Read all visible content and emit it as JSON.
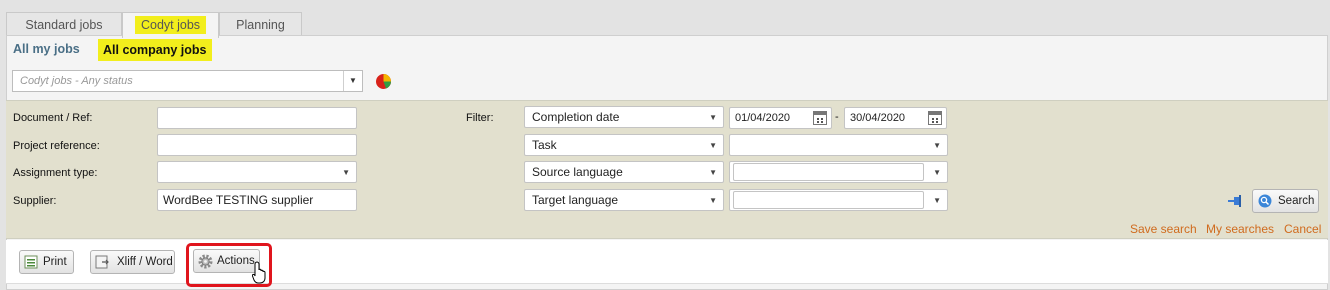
{
  "tabs": [
    {
      "label": "Standard jobs"
    },
    {
      "label": "Codyt jobs"
    },
    {
      "label": "Planning"
    }
  ],
  "subtabs": {
    "mine": "All my jobs",
    "company": "All company jobs"
  },
  "status_select": {
    "value": "Codyt jobs - Any status"
  },
  "form": {
    "document_ref": {
      "label": "Document / Ref:",
      "value": ""
    },
    "project_reference": {
      "label": "Project reference:",
      "value": ""
    },
    "assignment_type": {
      "label": "Assignment type:",
      "value": ""
    },
    "supplier": {
      "label": "Supplier:",
      "value": "WordBee TESTING supplier"
    },
    "filter_label": "Filter:",
    "filters": [
      {
        "field": "Completion date",
        "from": "01/04/2020",
        "to": "30/04/2020",
        "sep": "-"
      },
      {
        "field": "Task",
        "value": ""
      },
      {
        "field": "Source language",
        "value": ""
      },
      {
        "field": "Target language",
        "value": ""
      }
    ]
  },
  "search_button": "Search",
  "links": {
    "save_search": "Save search",
    "my_searches": "My searches",
    "cancel": "Cancel"
  },
  "toolbar": {
    "print": "Print",
    "xliff": "Xliff / Word",
    "actions": "Actions"
  },
  "colors": {
    "highlight": "#f2ee1c",
    "filter_bg": "#e2e0ce",
    "link": "#d06b1e",
    "callout": "#e0151d"
  }
}
